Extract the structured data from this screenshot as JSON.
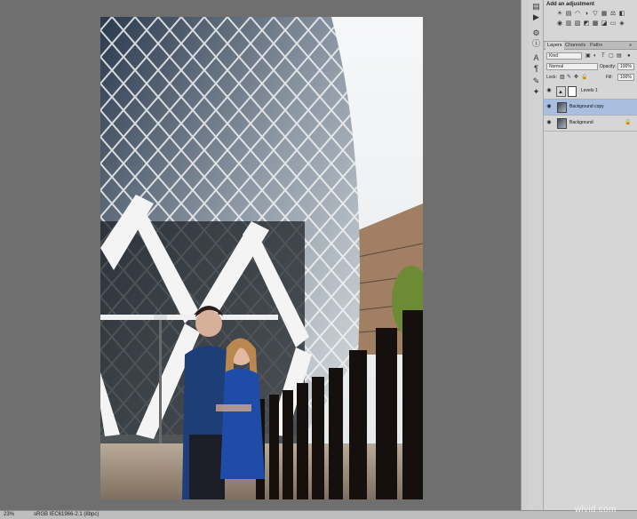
{
  "status_bar": {
    "zoom": "23%",
    "doc_profile": "sRGB IEC61966-2.1 (8bpc)"
  },
  "adjustments": {
    "header": "Add an adjustment",
    "icons": [
      "brightness-contrast-icon",
      "levels-icon",
      "curves-icon",
      "exposure-icon",
      "vibrance-icon",
      "hue-saturation-icon",
      "color-balance-icon",
      "black-white-icon",
      "photo-filter-icon",
      "channel-mixer-icon",
      "color-lookup-icon",
      "invert-icon",
      "posterize-icon",
      "threshold-icon",
      "gradient-map-icon",
      "selective-color-icon"
    ]
  },
  "layers_panel": {
    "tabs": [
      "Layers",
      "Channels",
      "Paths"
    ],
    "kind_label": "Kind",
    "blend_mode": "Normal",
    "opacity_label": "Opacity:",
    "opacity_value": "100%",
    "lock_label": "Lock:",
    "fill_label": "Fill:",
    "fill_value": "100%",
    "layers": [
      {
        "name": "Levels 1",
        "selected": false,
        "locked": false
      },
      {
        "name": "Background copy",
        "selected": true,
        "locked": false
      },
      {
        "name": "Background",
        "selected": false,
        "locked": true
      }
    ]
  },
  "watermark": "wlvid.com"
}
